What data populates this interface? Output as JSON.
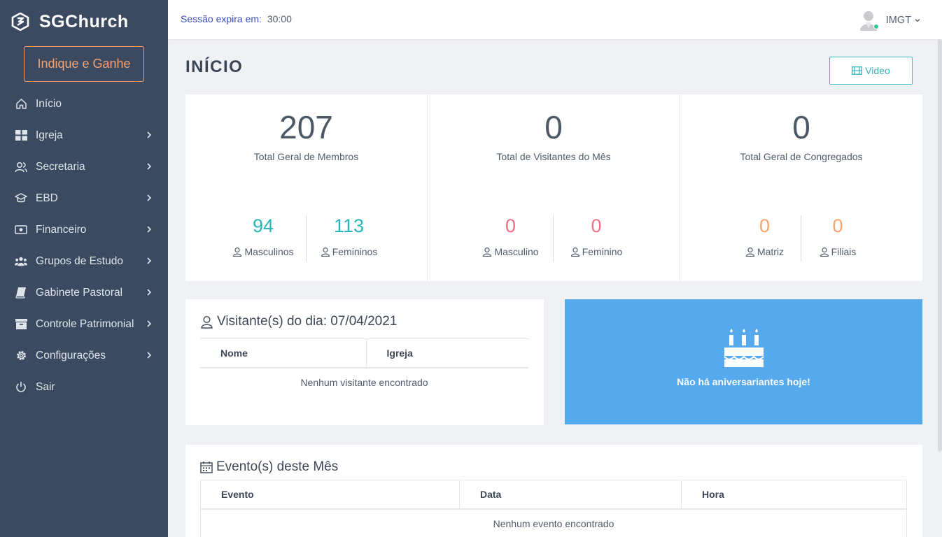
{
  "brand": {
    "name": "SGChurch"
  },
  "sidebar": {
    "refer_label": "Indique e Ganhe",
    "items": [
      {
        "label": "Início",
        "icon": "home-icon",
        "has_children": false
      },
      {
        "label": "Igreja",
        "icon": "grid-icon",
        "has_children": true
      },
      {
        "label": "Secretaria",
        "icon": "users-icon",
        "has_children": true
      },
      {
        "label": "EBD",
        "icon": "graduation-cap-icon",
        "has_children": true
      },
      {
        "label": "Financeiro",
        "icon": "money-icon",
        "has_children": true
      },
      {
        "label": "Grupos de Estudo",
        "icon": "group-icon",
        "has_children": true
      },
      {
        "label": "Gabinete Pastoral",
        "icon": "book-icon",
        "has_children": true
      },
      {
        "label": "Controle Patrimonial",
        "icon": "archive-icon",
        "has_children": true
      },
      {
        "label": "Configurações",
        "icon": "gear-icon",
        "has_children": true
      },
      {
        "label": "Sair",
        "icon": "power-icon",
        "has_children": false
      }
    ]
  },
  "topbar": {
    "session_label": "Sessão expira em:",
    "session_time": "30:00",
    "user_name": "IMGT"
  },
  "page": {
    "title": "INÍCIO",
    "video_label": "Video"
  },
  "stats": [
    {
      "value": "207",
      "label": "Total Geral de Membros",
      "subs": [
        {
          "value": "94",
          "label": "Masculinos"
        },
        {
          "value": "113",
          "label": "Femininos"
        }
      ]
    },
    {
      "value": "0",
      "label": "Total de Visitantes do Mês",
      "subs": [
        {
          "value": "0",
          "label": "Masculino"
        },
        {
          "value": "0",
          "label": "Feminino"
        }
      ]
    },
    {
      "value": "0",
      "label": "Total Geral de Congregados",
      "subs": [
        {
          "value": "0",
          "label": "Matriz"
        },
        {
          "value": "0",
          "label": "Filiais"
        }
      ]
    }
  ],
  "visitors": {
    "title": "Visitante(s) do dia: 07/04/2021",
    "columns": [
      "Nome",
      "Igreja"
    ],
    "empty": "Nenhum visitante encontrado"
  },
  "birthday": {
    "message": "Não há aniversariantes hoje!"
  },
  "events": {
    "title": "Evento(s) deste Mês",
    "columns": [
      "Evento",
      "Data",
      "Hora"
    ],
    "empty": "Nenhum evento encontrado"
  },
  "colors": {
    "sidebar_bg": "#3b4a60",
    "accent_orange": "#f7a36f",
    "teal": "#29b6b9",
    "pink": "#f06f86",
    "birthday_bg": "#56a9ec"
  }
}
